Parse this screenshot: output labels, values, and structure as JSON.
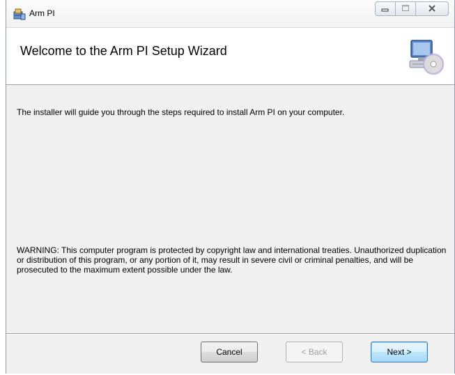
{
  "window": {
    "title": "Arm PI",
    "icon": "installer-app-icon",
    "controls": [
      "minimize-icon",
      "maximize-icon",
      "close-icon"
    ]
  },
  "banner": {
    "heading": "Welcome to the Arm PI Setup Wizard",
    "icon": "computer-cd-icon"
  },
  "body": {
    "intro": "The installer will guide you through the steps required to install Arm PI on your computer.",
    "warning": "WARNING: This computer program is protected by copyright law and international treaties. Unauthorized duplication or distribution of this program, or any portion of it, may result in severe civil or criminal penalties, and will be prosecuted to the maximum extent possible under the law."
  },
  "buttons": {
    "cancel": "Cancel",
    "back": "< Back",
    "next": "Next >",
    "back_disabled": true,
    "next_default": true
  },
  "colors": {
    "dialog_bg": "#f0f0f0",
    "banner_bg": "#ffffff",
    "default_button_border": "#3c7fb1"
  }
}
